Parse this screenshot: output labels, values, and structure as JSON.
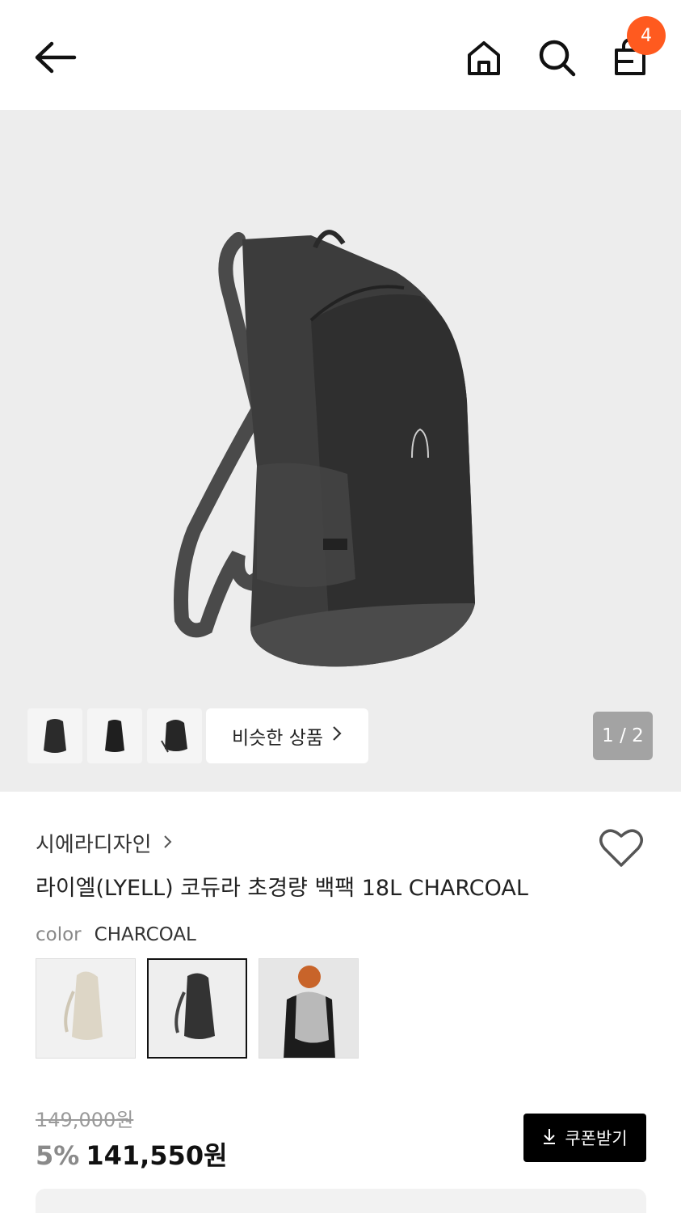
{
  "header": {
    "back_icon": "arrow-left-icon",
    "home_icon": "home-icon",
    "search_icon": "search-icon",
    "cart_icon": "shopping-bag-icon",
    "cart_count": "4",
    "badge_color": "#ff5a1f"
  },
  "gallery": {
    "similar_label": "비슷한 상품",
    "pager": "1 / 2",
    "thumbnails": [
      "backpack-front",
      "backpack-back",
      "backpack-side"
    ]
  },
  "product": {
    "brand": "시에라디자인",
    "title": "라이엘(LYELL) 코듀라 초경량 백팩 18L CHARCOAL",
    "color_label": "color",
    "color_value": "CHARCOAL",
    "swatches": [
      "beige",
      "charcoal",
      "model-gray"
    ],
    "original_price": "149,000원",
    "discount": "5%",
    "sale_price": "141,550원",
    "coupon_label": "쿠폰받기"
  }
}
